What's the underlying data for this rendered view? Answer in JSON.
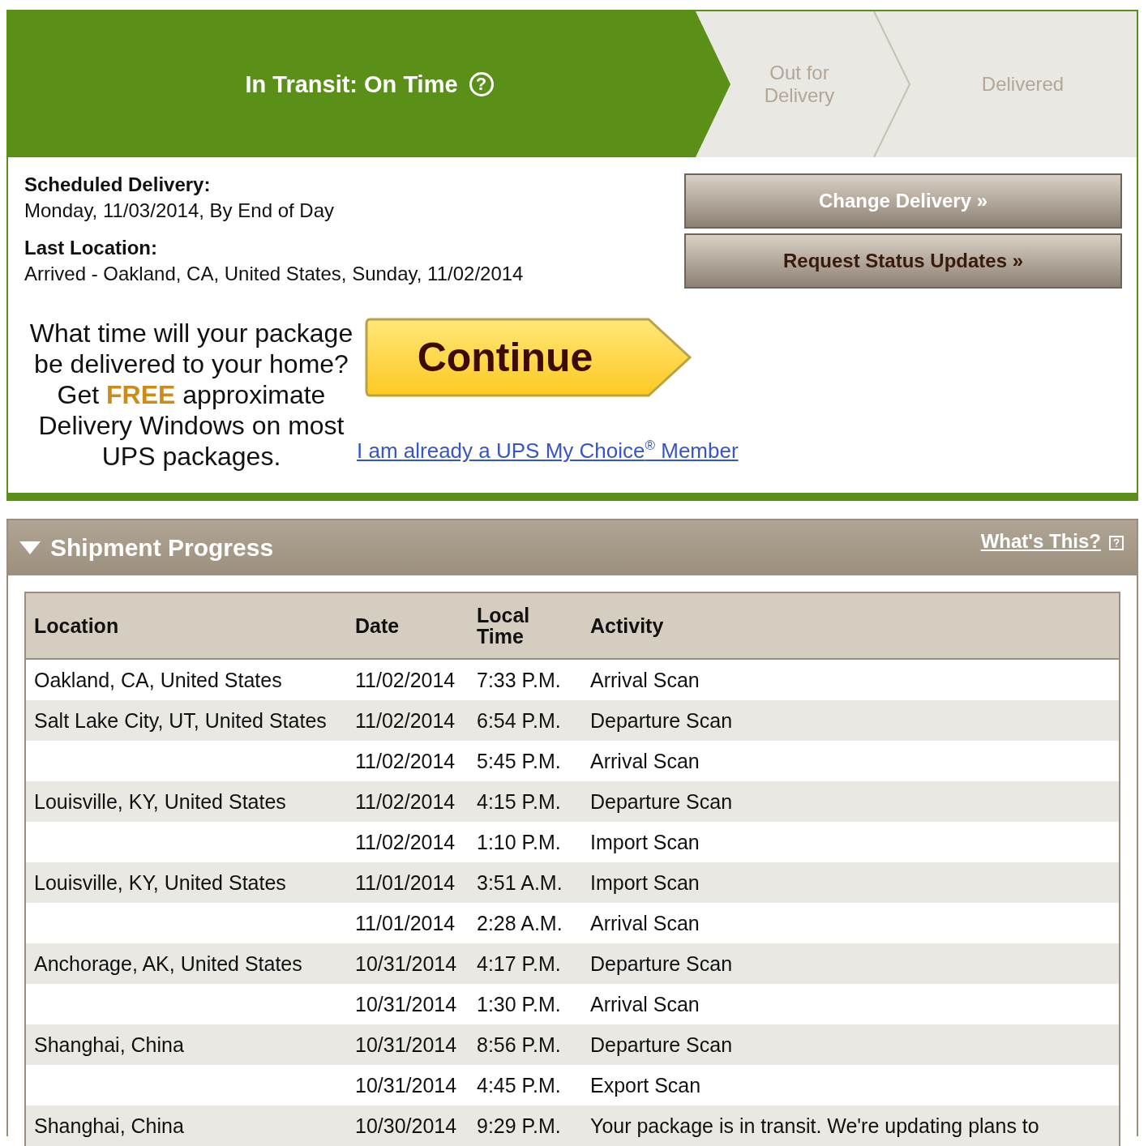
{
  "progress_steps": [
    {
      "label": "In Transit: On Time",
      "selected": true,
      "help_icon": "?"
    },
    {
      "label": "Out for Delivery",
      "selected": false
    },
    {
      "label": "Delivered",
      "selected": false
    }
  ],
  "details": [
    {
      "label": "Scheduled Delivery:",
      "value": "Monday, 11/03/2014, By End of Day"
    },
    {
      "label": "Last Location:",
      "value": "Arrived - Oakland, CA, United States, Sunday, 11/02/2014"
    }
  ],
  "actions": [
    {
      "label": "Change Delivery »",
      "kind": "light"
    },
    {
      "label": "Request Status Updates »",
      "kind": "dark"
    }
  ],
  "promo": {
    "text": "What time will your package be delivered to your home? Get **FREE** approximate Delivery Windows on most UPS packages.",
    "button": "Continue",
    "member_link": "I am already a UPS My Choice$^{®}$ Member"
  },
  "shipment_progress": {
    "title": "Shipment Progress",
    "expanded": true,
    "help_link": "What's This?",
    "table": {
      "columns": [
        "Location",
        "Date",
        "Local Time",
        "Activity"
      ],
      "rows": [
        [
          "Oakland, CA, United States",
          "11/02/2014",
          "7:33 P.M.",
          "Arrival Scan"
        ],
        [
          "Salt Lake City, UT, United States",
          "11/02/2014",
          "6:54 P.M.",
          "Departure Scan"
        ],
        [
          "",
          "11/02/2014",
          "5:45 P.M.",
          "Arrival Scan"
        ],
        [
          "Louisville, KY, United States",
          "11/02/2014",
          "4:15 P.M.",
          "Departure Scan"
        ],
        [
          "",
          "11/02/2014",
          "1:10 P.M.",
          "Import Scan"
        ],
        [
          "Louisville, KY, United States",
          "11/01/2014",
          "3:51 A.M.",
          "Import Scan"
        ],
        [
          "",
          "11/01/2014",
          "2:28 A.M.",
          "Arrival Scan"
        ],
        [
          "Anchorage, AK, United States",
          "10/31/2014",
          "4:17 P.M.",
          "Departure Scan"
        ],
        [
          "",
          "10/31/2014",
          "1:30 P.M.",
          "Arrival Scan"
        ],
        [
          "Shanghai, China",
          "10/31/2014",
          "8:56 P.M.",
          "Departure Scan"
        ],
        [
          "",
          "10/31/2014",
          "4:45 P.M.",
          "Export Scan"
        ],
        [
          "Shanghai, China",
          "10/30/2014",
          "9:29 P.M.",
          "Your package is in transit. We're updating plans to"
        ]
      ]
    }
  }
}
